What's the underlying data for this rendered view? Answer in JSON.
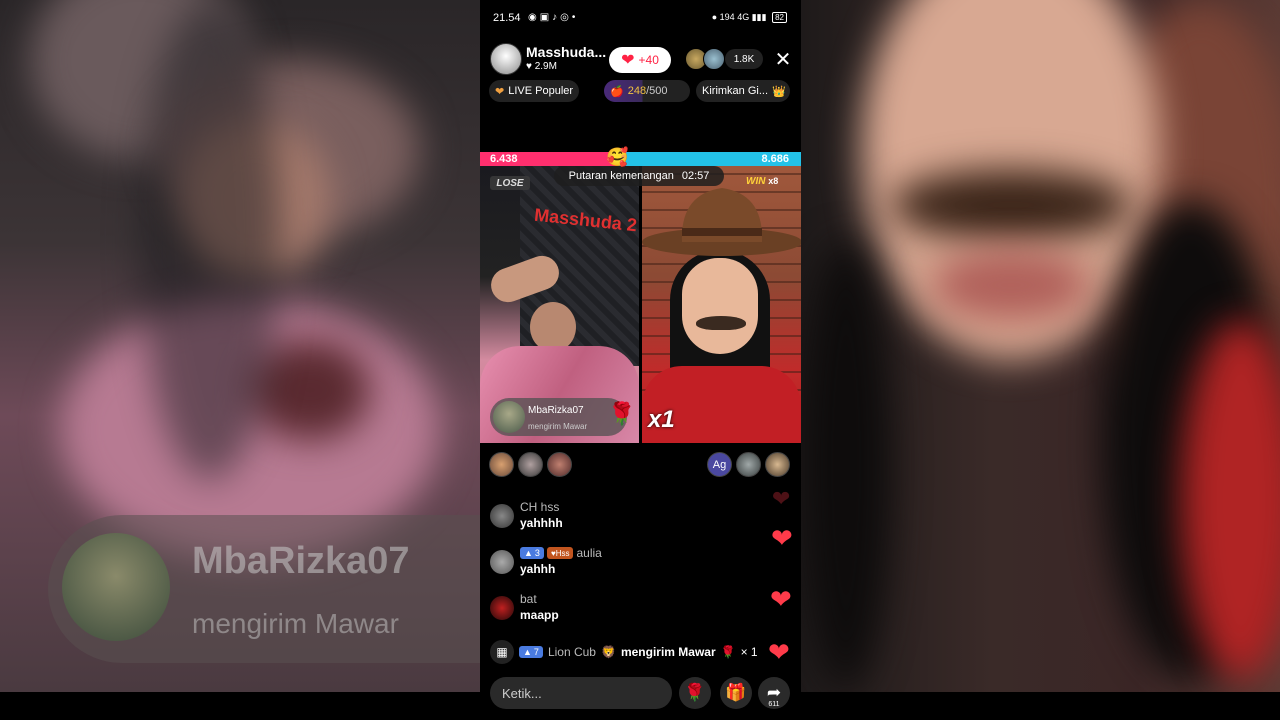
{
  "background": {
    "gift_sender_name": "MbaRizka07",
    "gift_sender_action": "mengirim Mawar"
  },
  "status_bar": {
    "time": "21.54",
    "network_speed": "194",
    "signal": "4G",
    "battery": "82"
  },
  "host": {
    "name": "Masshuda...",
    "likes": "2.9M",
    "like_button": "+40",
    "viewer_count": "1.8K"
  },
  "pills": {
    "popular": "LIVE Populer",
    "goal_value": "248",
    "goal_total": "/500",
    "send_gift": "Kirimkan Gi..."
  },
  "battle": {
    "score_left": "6.438",
    "score_right": "8.686",
    "round_label": "Putaran kemenangan",
    "timer": "02:57",
    "left_result": "LOSE",
    "right_result": "WIN",
    "right_multiplier": "x8",
    "studio_sign": "Masshuda 2",
    "multiplier_big": "x1"
  },
  "gift_card": {
    "name": "MbaRizka07",
    "action": "mengirim Mawar"
  },
  "supporters_right_initials": "Ag",
  "chat": [
    {
      "name": "CH hss",
      "message": "yahhhh"
    },
    {
      "level": "3",
      "fan_badge": "Hss",
      "name": "aulia",
      "message": "yahhh"
    },
    {
      "name": "bat",
      "message": "maapp"
    }
  ],
  "system_message": {
    "level": "7",
    "user": "Lion Cub",
    "action": "mengirim Mawar",
    "count": "× 1"
  },
  "input": {
    "placeholder": "Ketik..."
  },
  "share_count": "611",
  "colors": {
    "score_left": "#ff2f6e",
    "score_right": "#23c2e8",
    "heart": "#ff3b4a",
    "win": "#ffd23a"
  }
}
